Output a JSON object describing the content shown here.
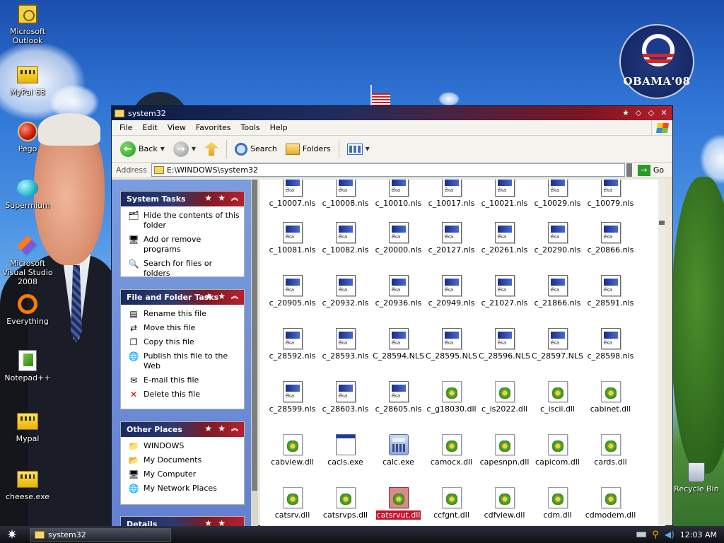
{
  "desktop": {
    "icons": [
      {
        "name": "desktop-icon-microsoft-outlook",
        "label": "Microsoft Outlook"
      },
      {
        "name": "desktop-icon-mypal68",
        "label": "MyPal 68"
      },
      {
        "name": "desktop-icon-pego",
        "label": "Pego"
      },
      {
        "name": "desktop-icon-supermium",
        "label": "Supermium"
      },
      {
        "name": "desktop-icon-visual-studio",
        "label": "Microsoft Visual Studio 2008"
      },
      {
        "name": "desktop-icon-everything",
        "label": "Everything"
      },
      {
        "name": "desktop-icon-notepadpp",
        "label": "Notepad++"
      },
      {
        "name": "desktop-icon-mypal",
        "label": "Mypal"
      },
      {
        "name": "desktop-icon-cheese",
        "label": "cheese.exe"
      }
    ],
    "recycle_bin": "Recycle Bin",
    "obama_logo_text": "OBAMA'08"
  },
  "window": {
    "title": "system32",
    "menu": [
      "File",
      "Edit",
      "View",
      "Favorites",
      "Tools",
      "Help"
    ],
    "toolbar": {
      "back": "Back",
      "search": "Search",
      "folders": "Folders"
    },
    "address_label": "Address",
    "address_value": "E:\\WINDOWS\\system32",
    "go_label": "Go"
  },
  "tasks": {
    "system": {
      "title": "System Tasks",
      "items": [
        "Hide the contents of this folder",
        "Add or remove programs",
        "Search for files or folders"
      ]
    },
    "file": {
      "title": "File and Folder Tasks",
      "items": [
        "Rename this file",
        "Move this file",
        "Copy this file",
        "Publish this file to the Web",
        "E-mail this file",
        "Delete this file"
      ]
    },
    "places": {
      "title": "Other Places",
      "items": [
        "WINDOWS",
        "My Documents",
        "My Computer",
        "My Network Places"
      ]
    },
    "details": {
      "title": "Details"
    }
  },
  "files": [
    [
      "c_10007.nls",
      "c_10008.nls",
      "c_10010.nls",
      "c_10017.nls",
      "c_10021.nls",
      "c_10029.nls",
      "c_10079.nls"
    ],
    [
      "c_10081.nls",
      "c_10082.nls",
      "c_20000.nls",
      "c_20127.nls",
      "c_20261.nls",
      "c_20290.nls",
      "c_20866.nls"
    ],
    [
      "c_20905.nls",
      "c_20932.nls",
      "c_20936.nls",
      "c_20949.nls",
      "c_21027.nls",
      "c_21866.nls",
      "c_28591.nls"
    ],
    [
      "c_28592.nls",
      "c_28593.nls",
      "C_28594.NLS",
      "C_28595.NLS",
      "C_28596.NLS",
      "C_28597.NLS",
      "c_28598.nls"
    ],
    [
      "c_28599.nls",
      "c_28603.nls",
      "c_28605.nls",
      "c_g18030.dll",
      "c_is2022.dll",
      "c_iscii.dll",
      "cabinet.dll"
    ],
    [
      "cabview.dll",
      "cacls.exe",
      "calc.exe",
      "camocx.dll",
      "capesnpn.dll",
      "capicom.dll",
      "cards.dll"
    ],
    [
      "catsrv.dll",
      "catsrvps.dll",
      "catsrvut.dll",
      "ccfgnt.dll",
      "cdfview.dll",
      "cdm.dll",
      "cdmodem.dll"
    ]
  ],
  "selected_file": "catsrvut.dll",
  "taskbar": {
    "task": "system32",
    "clock": "12:03 AM"
  }
}
